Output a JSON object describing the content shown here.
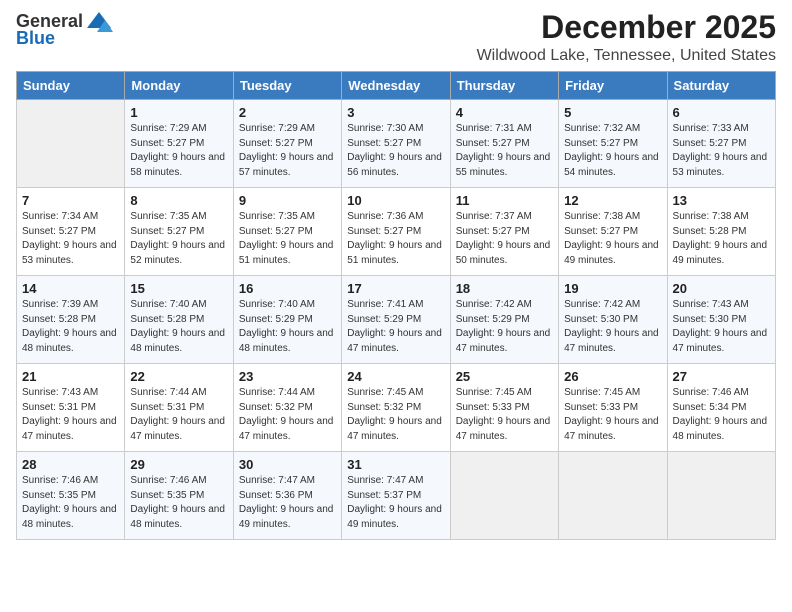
{
  "logo": {
    "general": "General",
    "blue": "Blue"
  },
  "title": "December 2025",
  "location": "Wildwood Lake, Tennessee, United States",
  "days_of_week": [
    "Sunday",
    "Monday",
    "Tuesday",
    "Wednesday",
    "Thursday",
    "Friday",
    "Saturday"
  ],
  "weeks": [
    [
      {
        "day": "",
        "sunrise": "",
        "sunset": "",
        "daylight": ""
      },
      {
        "day": "1",
        "sunrise": "Sunrise: 7:29 AM",
        "sunset": "Sunset: 5:27 PM",
        "daylight": "Daylight: 9 hours and 58 minutes."
      },
      {
        "day": "2",
        "sunrise": "Sunrise: 7:29 AM",
        "sunset": "Sunset: 5:27 PM",
        "daylight": "Daylight: 9 hours and 57 minutes."
      },
      {
        "day": "3",
        "sunrise": "Sunrise: 7:30 AM",
        "sunset": "Sunset: 5:27 PM",
        "daylight": "Daylight: 9 hours and 56 minutes."
      },
      {
        "day": "4",
        "sunrise": "Sunrise: 7:31 AM",
        "sunset": "Sunset: 5:27 PM",
        "daylight": "Daylight: 9 hours and 55 minutes."
      },
      {
        "day": "5",
        "sunrise": "Sunrise: 7:32 AM",
        "sunset": "Sunset: 5:27 PM",
        "daylight": "Daylight: 9 hours and 54 minutes."
      },
      {
        "day": "6",
        "sunrise": "Sunrise: 7:33 AM",
        "sunset": "Sunset: 5:27 PM",
        "daylight": "Daylight: 9 hours and 53 minutes."
      }
    ],
    [
      {
        "day": "7",
        "sunrise": "Sunrise: 7:34 AM",
        "sunset": "Sunset: 5:27 PM",
        "daylight": "Daylight: 9 hours and 53 minutes."
      },
      {
        "day": "8",
        "sunrise": "Sunrise: 7:35 AM",
        "sunset": "Sunset: 5:27 PM",
        "daylight": "Daylight: 9 hours and 52 minutes."
      },
      {
        "day": "9",
        "sunrise": "Sunrise: 7:35 AM",
        "sunset": "Sunset: 5:27 PM",
        "daylight": "Daylight: 9 hours and 51 minutes."
      },
      {
        "day": "10",
        "sunrise": "Sunrise: 7:36 AM",
        "sunset": "Sunset: 5:27 PM",
        "daylight": "Daylight: 9 hours and 51 minutes."
      },
      {
        "day": "11",
        "sunrise": "Sunrise: 7:37 AM",
        "sunset": "Sunset: 5:27 PM",
        "daylight": "Daylight: 9 hours and 50 minutes."
      },
      {
        "day": "12",
        "sunrise": "Sunrise: 7:38 AM",
        "sunset": "Sunset: 5:27 PM",
        "daylight": "Daylight: 9 hours and 49 minutes."
      },
      {
        "day": "13",
        "sunrise": "Sunrise: 7:38 AM",
        "sunset": "Sunset: 5:28 PM",
        "daylight": "Daylight: 9 hours and 49 minutes."
      }
    ],
    [
      {
        "day": "14",
        "sunrise": "Sunrise: 7:39 AM",
        "sunset": "Sunset: 5:28 PM",
        "daylight": "Daylight: 9 hours and 48 minutes."
      },
      {
        "day": "15",
        "sunrise": "Sunrise: 7:40 AM",
        "sunset": "Sunset: 5:28 PM",
        "daylight": "Daylight: 9 hours and 48 minutes."
      },
      {
        "day": "16",
        "sunrise": "Sunrise: 7:40 AM",
        "sunset": "Sunset: 5:29 PM",
        "daylight": "Daylight: 9 hours and 48 minutes."
      },
      {
        "day": "17",
        "sunrise": "Sunrise: 7:41 AM",
        "sunset": "Sunset: 5:29 PM",
        "daylight": "Daylight: 9 hours and 47 minutes."
      },
      {
        "day": "18",
        "sunrise": "Sunrise: 7:42 AM",
        "sunset": "Sunset: 5:29 PM",
        "daylight": "Daylight: 9 hours and 47 minutes."
      },
      {
        "day": "19",
        "sunrise": "Sunrise: 7:42 AM",
        "sunset": "Sunset: 5:30 PM",
        "daylight": "Daylight: 9 hours and 47 minutes."
      },
      {
        "day": "20",
        "sunrise": "Sunrise: 7:43 AM",
        "sunset": "Sunset: 5:30 PM",
        "daylight": "Daylight: 9 hours and 47 minutes."
      }
    ],
    [
      {
        "day": "21",
        "sunrise": "Sunrise: 7:43 AM",
        "sunset": "Sunset: 5:31 PM",
        "daylight": "Daylight: 9 hours and 47 minutes."
      },
      {
        "day": "22",
        "sunrise": "Sunrise: 7:44 AM",
        "sunset": "Sunset: 5:31 PM",
        "daylight": "Daylight: 9 hours and 47 minutes."
      },
      {
        "day": "23",
        "sunrise": "Sunrise: 7:44 AM",
        "sunset": "Sunset: 5:32 PM",
        "daylight": "Daylight: 9 hours and 47 minutes."
      },
      {
        "day": "24",
        "sunrise": "Sunrise: 7:45 AM",
        "sunset": "Sunset: 5:32 PM",
        "daylight": "Daylight: 9 hours and 47 minutes."
      },
      {
        "day": "25",
        "sunrise": "Sunrise: 7:45 AM",
        "sunset": "Sunset: 5:33 PM",
        "daylight": "Daylight: 9 hours and 47 minutes."
      },
      {
        "day": "26",
        "sunrise": "Sunrise: 7:45 AM",
        "sunset": "Sunset: 5:33 PM",
        "daylight": "Daylight: 9 hours and 47 minutes."
      },
      {
        "day": "27",
        "sunrise": "Sunrise: 7:46 AM",
        "sunset": "Sunset: 5:34 PM",
        "daylight": "Daylight: 9 hours and 48 minutes."
      }
    ],
    [
      {
        "day": "28",
        "sunrise": "Sunrise: 7:46 AM",
        "sunset": "Sunset: 5:35 PM",
        "daylight": "Daylight: 9 hours and 48 minutes."
      },
      {
        "day": "29",
        "sunrise": "Sunrise: 7:46 AM",
        "sunset": "Sunset: 5:35 PM",
        "daylight": "Daylight: 9 hours and 48 minutes."
      },
      {
        "day": "30",
        "sunrise": "Sunrise: 7:47 AM",
        "sunset": "Sunset: 5:36 PM",
        "daylight": "Daylight: 9 hours and 49 minutes."
      },
      {
        "day": "31",
        "sunrise": "Sunrise: 7:47 AM",
        "sunset": "Sunset: 5:37 PM",
        "daylight": "Daylight: 9 hours and 49 minutes."
      },
      {
        "day": "",
        "sunrise": "",
        "sunset": "",
        "daylight": ""
      },
      {
        "day": "",
        "sunrise": "",
        "sunset": "",
        "daylight": ""
      },
      {
        "day": "",
        "sunrise": "",
        "sunset": "",
        "daylight": ""
      }
    ]
  ]
}
